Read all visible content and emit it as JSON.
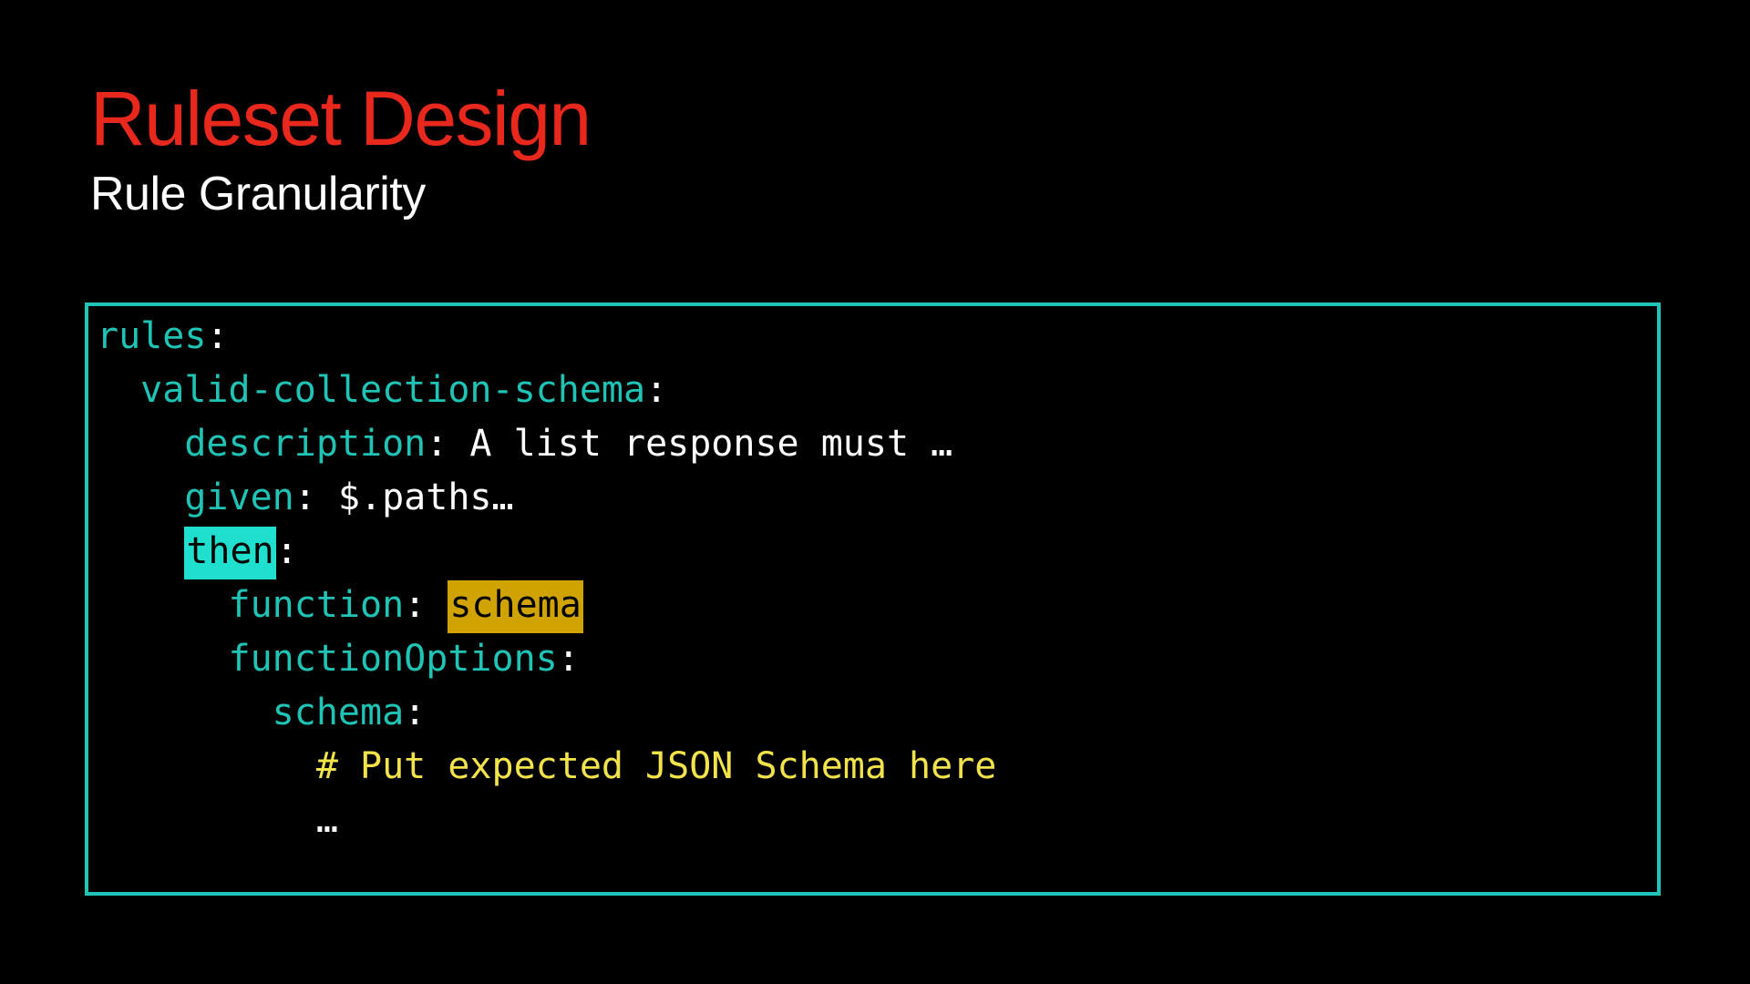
{
  "slide": {
    "title": "Ruleset Design",
    "subtitle": "Rule Granularity"
  },
  "code": {
    "lines": [
      {
        "indent": "",
        "key": "rules",
        "sep": ":"
      },
      {
        "indent": "  ",
        "key": "valid-collection-schema",
        "sep": ":"
      },
      {
        "indent": "    ",
        "key": "description",
        "sep": ": ",
        "value": "A list response must …"
      },
      {
        "indent": "    ",
        "key": "given",
        "sep": ": ",
        "value": "$.paths…"
      },
      {
        "indent": "    ",
        "key": "then",
        "sep": ":"
      },
      {
        "indent": "      ",
        "key": "function",
        "sep": ": ",
        "value": "schema"
      },
      {
        "indent": "      ",
        "key": "functionOptions",
        "sep": ":"
      },
      {
        "indent": "        ",
        "key": "schema",
        "sep": ":"
      },
      {
        "indent": "          ",
        "comment": "# Put expected JSON Schema here"
      },
      {
        "indent": "          ",
        "value": "…"
      }
    ]
  },
  "colors": {
    "title": "#e8281c",
    "subtitle": "#ffffff",
    "border": "#21c4b8",
    "key": "#1fc4b6",
    "comment": "#f2e34a",
    "highlight_then": "#1fe0cf",
    "highlight_schema": "#d1a300"
  }
}
